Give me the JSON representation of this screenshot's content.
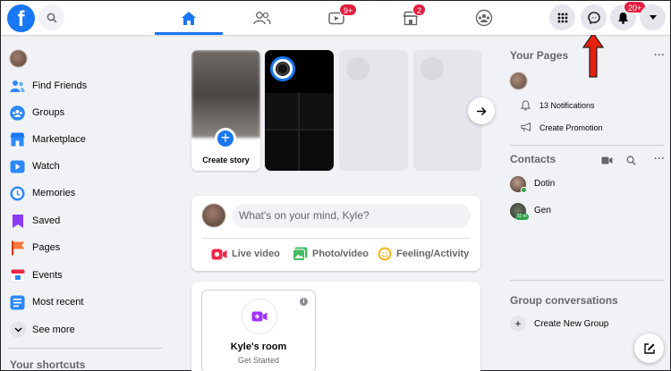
{
  "topbar": {
    "logo": "f",
    "nav": [
      {
        "name": "home",
        "icon": "home-icon",
        "active": true,
        "badge": ""
      },
      {
        "name": "friends",
        "icon": "friends-icon",
        "active": false,
        "badge": ""
      },
      {
        "name": "watch",
        "icon": "watch-icon",
        "active": false,
        "badge": "9+"
      },
      {
        "name": "marketplace",
        "icon": "marketplace-icon",
        "active": false,
        "badge": "2"
      },
      {
        "name": "groups",
        "icon": "groups-icon",
        "active": false,
        "badge": ""
      }
    ],
    "notifications_badge": "20+"
  },
  "sidebar": {
    "items": [
      {
        "label": "Find Friends",
        "icon": "find-friends-icon"
      },
      {
        "label": "Groups",
        "icon": "groups-icon"
      },
      {
        "label": "Marketplace",
        "icon": "marketplace-icon"
      },
      {
        "label": "Watch",
        "icon": "watch-icon"
      },
      {
        "label": "Memories",
        "icon": "memories-icon"
      },
      {
        "label": "Saved",
        "icon": "saved-icon"
      },
      {
        "label": "Pages",
        "icon": "pages-icon"
      },
      {
        "label": "Events",
        "icon": "events-icon"
      },
      {
        "label": "Most recent",
        "icon": "most-recent-icon"
      },
      {
        "label": "See more",
        "icon": "chevron-down-icon"
      }
    ],
    "shortcuts_title": "Your shortcuts"
  },
  "stories": {
    "create_label": "Create story"
  },
  "composer": {
    "placeholder": "What's on your mind, Kyle?",
    "actions": [
      {
        "label": "Live video",
        "icon": "live-video-icon",
        "color": "#f02849"
      },
      {
        "label": "Photo/video",
        "icon": "photo-video-icon",
        "color": "#45bd62"
      },
      {
        "label": "Feeling/Activity",
        "icon": "feeling-icon",
        "color": "#f7b928"
      }
    ]
  },
  "room": {
    "title": "Kyle's room",
    "subtitle": "Get Started",
    "info": "i"
  },
  "right": {
    "pages_title": "Your Pages",
    "notifications": "13 Notifications",
    "create_promotion": "Create Promotion",
    "contacts_title": "Contacts",
    "contacts": [
      {
        "name": "Dotin",
        "status": "online"
      },
      {
        "name": "Gen",
        "status": "11 m"
      }
    ],
    "group_title": "Group conversations",
    "new_group": "Create New Group",
    "more": "···"
  },
  "colors": {
    "brand": "#1877f2",
    "badge": "#e41e3f",
    "annotation_arrow": "#e8200e"
  }
}
